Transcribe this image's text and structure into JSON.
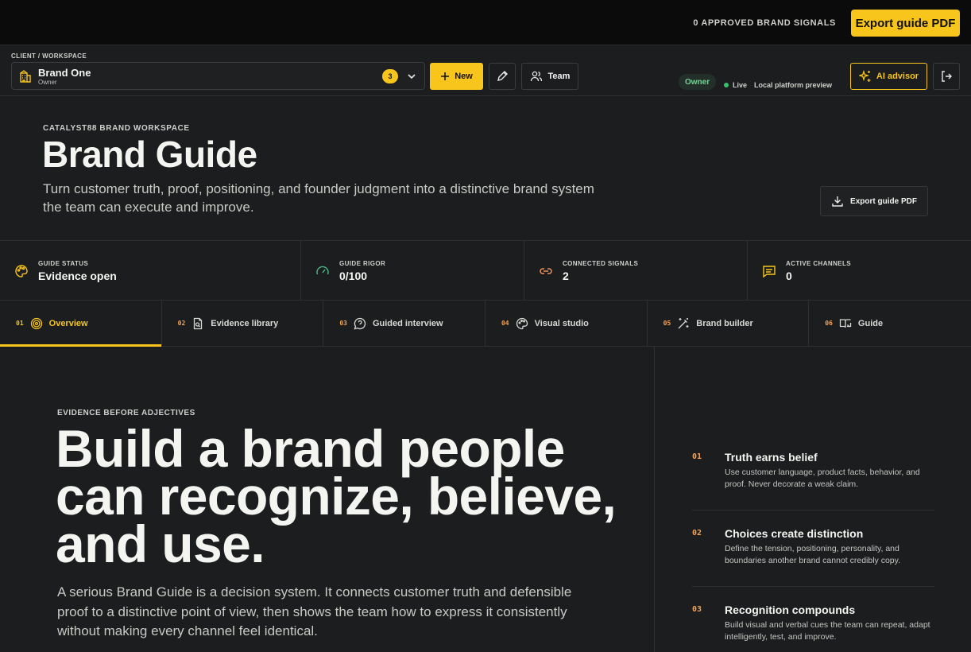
{
  "topbar": {
    "signals": "0 APPROVED BRAND SIGNALS",
    "export_label": "Export guide PDF"
  },
  "context": {
    "breadcrumb": "CLIENT / WORKSPACE",
    "workspace_name": "Brand One",
    "workspace_role": "Owner",
    "workspace_count": "3",
    "new_label": "New",
    "team_label": "Team",
    "owner_badge": "Owner",
    "live_label": "Live",
    "preview_label": "Local platform preview",
    "advisor_label": "AI advisor"
  },
  "hero": {
    "eyebrow": "CATALYST88 BRAND WORKSPACE",
    "title": "Brand Guide",
    "subtitle": "Turn customer truth, proof, positioning, and founder judgment into a distinctive brand system the team can execute and improve.",
    "export_label": "Export guide PDF"
  },
  "stats": [
    {
      "label": "GUIDE STATUS",
      "value": "Evidence open",
      "icon": "palette-icon"
    },
    {
      "label": "GUIDE RIGOR",
      "value": "0/100",
      "icon": "gauge-icon"
    },
    {
      "label": "CONNECTED SIGNALS",
      "value": "2",
      "icon": "link-icon"
    },
    {
      "label": "ACTIVE CHANNELS",
      "value": "0",
      "icon": "message-icon"
    }
  ],
  "tabs": [
    {
      "num": "01",
      "label": "Overview",
      "icon": "target-icon",
      "active": true
    },
    {
      "num": "02",
      "label": "Evidence library",
      "icon": "file-search-icon"
    },
    {
      "num": "03",
      "label": "Guided interview",
      "icon": "question-bubble-icon"
    },
    {
      "num": "04",
      "label": "Visual studio",
      "icon": "palette-icon"
    },
    {
      "num": "05",
      "label": "Brand builder",
      "icon": "magic-wand-icon"
    },
    {
      "num": "06",
      "label": "Guide",
      "icon": "book-open-icon"
    }
  ],
  "main": {
    "eyebrow": "EVIDENCE BEFORE ADJECTIVES",
    "title": "Build a brand people can recognize, believe, and use.",
    "body": "A serious Brand Guide is a decision system. It connects customer truth and defensible proof to a distinctive point of view, then shows the team how to express it consistently without making every channel feel identical."
  },
  "principles": [
    {
      "num": "01",
      "title": "Truth earns belief",
      "body": "Use customer language, product facts, behavior, and proof. Never decorate a weak claim."
    },
    {
      "num": "02",
      "title": "Choices create distinction",
      "body": "Define the tension, positioning, personality, and boundaries another brand cannot credibly copy."
    },
    {
      "num": "03",
      "title": "Recognition compounds",
      "body": "Build visual and verbal cues the team can repeat, adapt intelligently, test, and improve."
    }
  ],
  "colors": {
    "accent": "#f7c51b",
    "number": "#f4a35a",
    "live": "#36c26b",
    "background": "#1b1d1f"
  }
}
